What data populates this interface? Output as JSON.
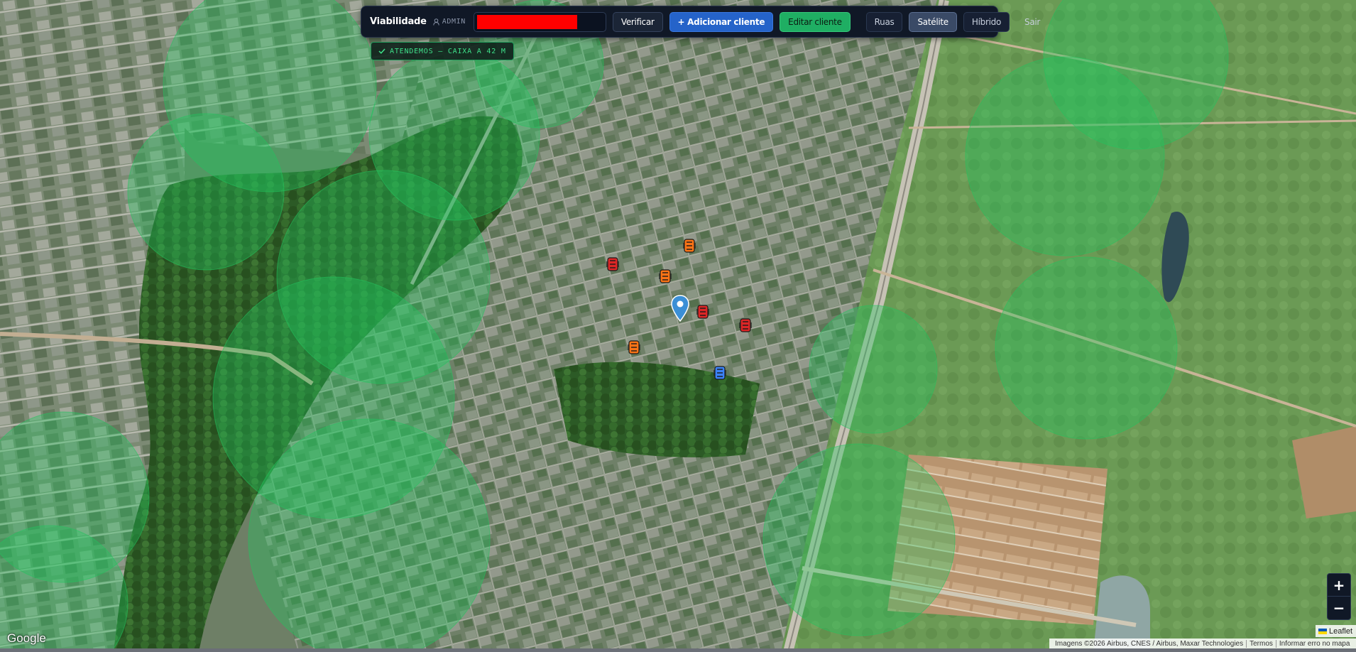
{
  "toolbar": {
    "brand": "Viabilidade",
    "role": "ADMIN",
    "search_value": "",
    "verify_label": "Verificar",
    "add_client_label": "+ Adicionar cliente",
    "edit_client_label": "Editar cliente",
    "layers": [
      {
        "label": "Ruas",
        "active": false
      },
      {
        "label": "Satélite",
        "active": true
      },
      {
        "label": "Híbrido",
        "active": false
      }
    ],
    "logout_label": "Sair"
  },
  "status": {
    "text": "ATENDEMOS — CAIXA A 42 M",
    "color": "#3ee089"
  },
  "zoom": {
    "in_label": "+",
    "out_label": "−"
  },
  "map": {
    "coverage_color": "#22c55e",
    "boxes": [
      {
        "type": "orange",
        "color": "#f97316"
      },
      {
        "type": "red",
        "color": "#dc2626"
      },
      {
        "type": "blue",
        "color": "#3b82f6"
      }
    ],
    "marker": {
      "icon": "map-pin-icon",
      "color": "#3b8fd6"
    }
  },
  "google_logo": "Google",
  "attribution": {
    "leaflet": "Leaflet",
    "imagery": "Imagens ©2026 Airbus, CNES / Airbus, Maxar Technologies",
    "terms": "Termos",
    "report": "Informar erro no mapa"
  }
}
